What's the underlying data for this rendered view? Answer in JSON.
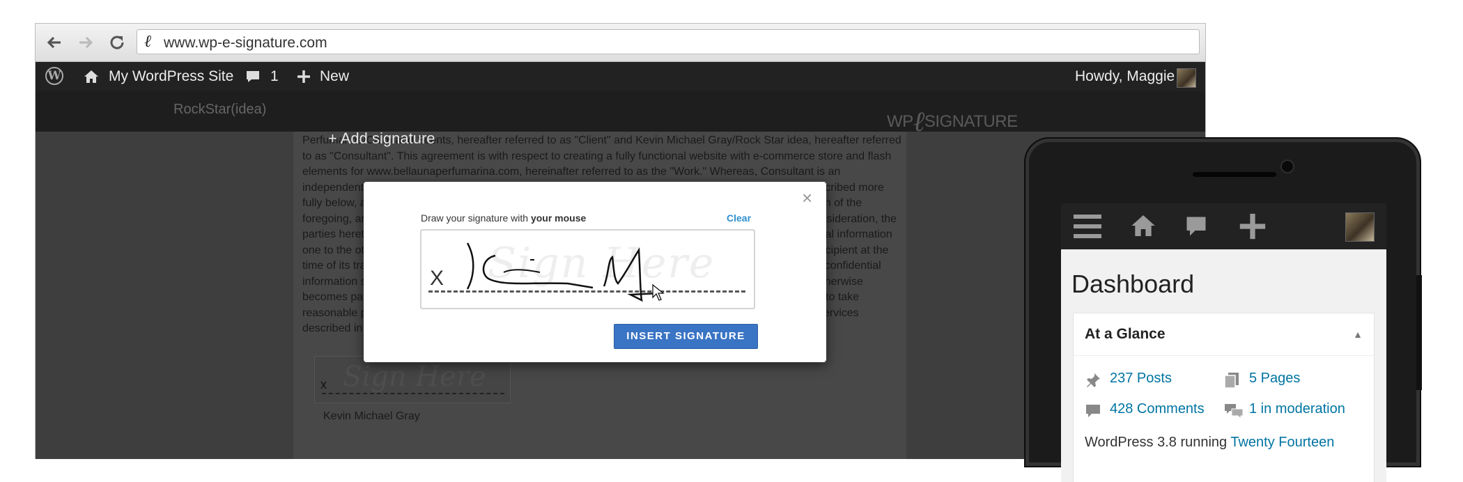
{
  "browser": {
    "back_icon": "arrow-left-icon",
    "forward_icon": "arrow-right-icon",
    "reload_icon": "reload-icon",
    "url": "www.wp-e-signature.com"
  },
  "adminbar": {
    "site_name": "My WordPress Site",
    "comment_count": "1",
    "new_label": "New",
    "greeting": "Howdy, Maggie"
  },
  "site": {
    "brand": "RockStar(idea)",
    "logo_wp": "WP",
    "logo_signature": "SIGNATURE"
  },
  "document": {
    "text": "Perfumarina/Calm and Scents, hereafter referred to as \"Client\" and Kevin Michael Gray/Rock Star idea, hereafter referred to as \"Consultant\". This agreement is with respect to creating a fully functional website with e-commerce store and flash elements for www.bellaunaperfumarina.com, hereinafter referred to as the \"Work.\" Whereas, Consultant is an independent contractor who will perform certain services for Client in connection with the certain Work described more fully below, and Client desires to engage Consultant to perform such services in return for the consideration of the foregoing, and in exchange for the mutual promises herein contained, and for other good and valuable consideration, the parties hereto agree as follows. Consultant agrees that all information disclosed to Consultant is confidential information one to the other, which was not generally known to the public, or which was not in the possession of the recipient at the time of its transmittal, and which was identified as confidential at the time of disclosure or thereafter. Such confidential information shall remain confidential unless and until such information is expressly released by Client or otherwise becomes part of the public domain. Consultant agrees not to disclose Client's confidential information and to take reasonable precautions to keep confidential all such information. Consultant shall provide Client with the services described in this agreement to describe the Work that is to be completed.",
    "add_signature": "+ Add signature",
    "signature_placeholder": "Sign Here",
    "signature_x": "x",
    "signer_name": "Kevin Michael Gray"
  },
  "modal": {
    "close_label": "×",
    "instruction_prefix": "Draw your signature with ",
    "instruction_bold": "your mouse",
    "clear_label": "Clear",
    "pad_x": "X",
    "pad_placeholder": "Sign Here",
    "insert_label": "INSERT SIGNATURE"
  },
  "phone": {
    "menu_icon": "menu-icon",
    "home_icon": "home-icon",
    "comments_icon": "comment-icon",
    "add_icon": "plus-icon",
    "page_title": "Dashboard",
    "widget_title": "At a Glance",
    "posts": "237 Posts",
    "pages": "5 Pages",
    "comments": "428 Comments",
    "moderation": "1 in moderation",
    "footer_prefix": "WordPress 3.8 running ",
    "theme": "Twenty Fourteen"
  },
  "colors": {
    "admin_bar": "#222222",
    "primary_button": "#3a74c4",
    "link": "#0074a2",
    "clear_link": "#2f8fd1"
  }
}
